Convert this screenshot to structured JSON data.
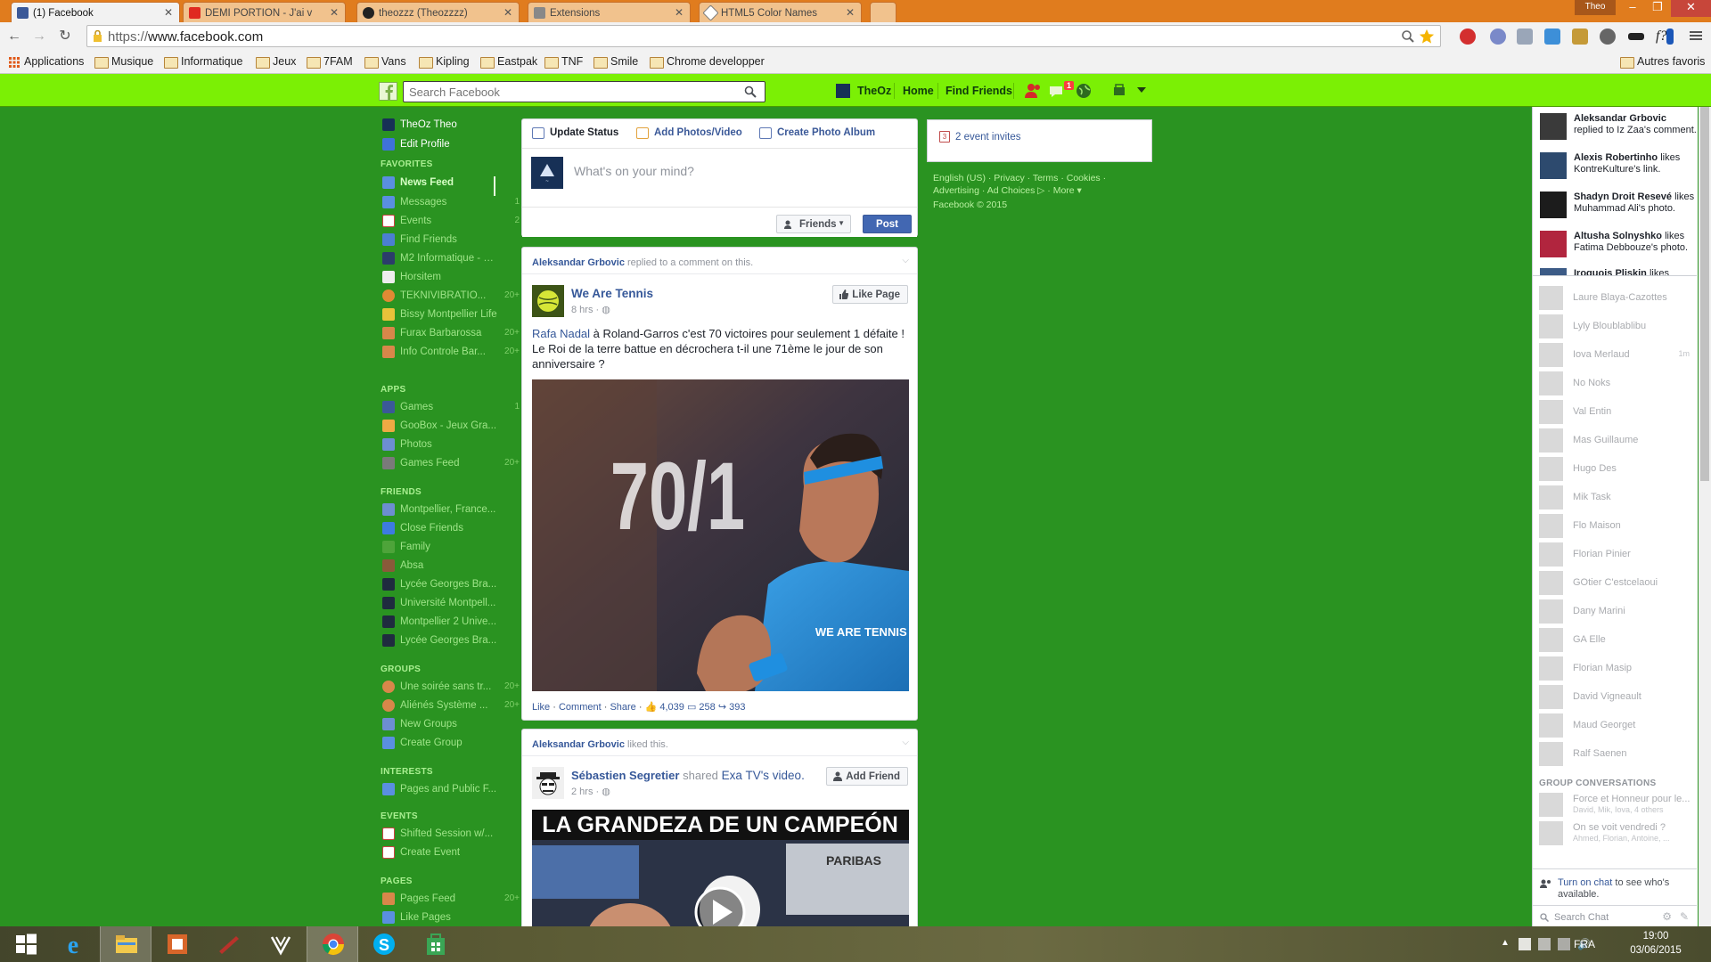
{
  "window": {
    "user_badge": "Theo",
    "tabs": [
      {
        "title": "(1) Facebook",
        "active": true
      },
      {
        "title": "DEMI PORTION - J'ai v"
      },
      {
        "title": "theozzz (Theozzzz)"
      },
      {
        "title": "Extensions"
      },
      {
        "title": "HTML5 Color Names"
      }
    ]
  },
  "toolbar": {
    "url_scheme": "https://",
    "url_host": "www.facebook.com"
  },
  "bookmarks": {
    "items": [
      "Applications",
      "Musique",
      "Informatique",
      "Jeux",
      "7FAM",
      "Vans",
      "Kipling",
      "Eastpak",
      "TNF",
      "Smile",
      "Chrome developper"
    ],
    "other": "Autres favoris"
  },
  "fbbar": {
    "search_placeholder": "Search Facebook",
    "profile_name": "TheOz",
    "home": "Home",
    "find_friends": "Find Friends",
    "notif_count": "1"
  },
  "leftnav": {
    "profile": {
      "name": "TheOz Theo",
      "edit": "Edit Profile"
    },
    "favorites_head": "FAVORITES",
    "favorites": [
      {
        "label": "News Feed",
        "count": ""
      },
      {
        "label": "Messages",
        "count": "1"
      },
      {
        "label": "Events",
        "count": "2"
      },
      {
        "label": "Find Friends",
        "count": ""
      },
      {
        "label": "M2 Informatique - U...",
        "count": ""
      },
      {
        "label": "Horsitem",
        "count": ""
      },
      {
        "label": "TEKNIVIBRATIO...",
        "count": "20+"
      },
      {
        "label": "Bissy Montpellier Life",
        "count": ""
      },
      {
        "label": "Furax Barbarossa",
        "count": "20+"
      },
      {
        "label": "Info Controle Bar...",
        "count": "20+"
      }
    ],
    "apps_head": "APPS",
    "apps": [
      {
        "label": "Games",
        "count": "1"
      },
      {
        "label": "GooBox - Jeux Gra...",
        "count": ""
      },
      {
        "label": "Photos",
        "count": ""
      },
      {
        "label": "Games Feed",
        "count": "20+"
      }
    ],
    "friends_head": "FRIENDS",
    "friends": [
      {
        "label": "Montpellier, France..."
      },
      {
        "label": "Close Friends"
      },
      {
        "label": "Family"
      },
      {
        "label": "Absa"
      },
      {
        "label": "Lycée Georges Bra..."
      },
      {
        "label": "Université Montpell..."
      },
      {
        "label": "Montpellier 2 Unive..."
      },
      {
        "label": "Lycée Georges Bra..."
      }
    ],
    "groups_head": "GROUPS",
    "groups": [
      {
        "label": "Une soirée sans tr...",
        "count": "20+"
      },
      {
        "label": "Aliénés Système ...",
        "count": "20+"
      },
      {
        "label": "New Groups",
        "count": ""
      },
      {
        "label": "Create Group",
        "count": ""
      }
    ],
    "interests_head": "INTERESTS",
    "interests": [
      {
        "label": "Pages and Public F..."
      }
    ],
    "events_head": "EVENTS",
    "events": [
      {
        "label": "Shifted Session w/..."
      },
      {
        "label": "Create Event"
      }
    ],
    "pages_head": "PAGES",
    "pages": [
      {
        "label": "Pages Feed",
        "count": "20+"
      },
      {
        "label": "Like Pages",
        "count": ""
      }
    ]
  },
  "composer": {
    "update_status": "Update Status",
    "add_photos": "Add Photos/Video",
    "create_album": "Create Photo Album",
    "placeholder": "What's on your mind?",
    "audience": "Friends",
    "post": "Post"
  },
  "story1": {
    "actor": "Aleksandar Grbovic",
    "action": "replied to a comment on this.",
    "page": "We Are Tennis",
    "time": "8 hrs",
    "like_page": "Like Page",
    "text_link": "Rafa Nadal",
    "text_rest": " à Roland-Garros c'est 70 victoires pour seulement 1 défaite ! Le Roi de la terre battue en décrochera t-il une 71ème le jour de son anniversaire ?",
    "image_score": "70/1",
    "image_brand": "WE ARE TENNIS .COM",
    "like": "Like",
    "comment": "Comment",
    "share": "Share",
    "likes": "4,039",
    "comments": "258",
    "shares": "393"
  },
  "story2": {
    "actor": "Aleksandar Grbovic",
    "action": "liked this.",
    "name": "Sébastien Segretier",
    "shared": "shared",
    "source": "Exa TV's",
    "object": "video.",
    "time": "2 hrs",
    "add_friend": "Add Friend",
    "video_title": "LA GRANDEZA DE UN CAMPEÓN",
    "video_sponsor": "PARIBAS"
  },
  "right": {
    "event_invites": "2 event invites",
    "footer_line1": "English (US) · Privacy · Terms · Cookies ·",
    "footer_line2": "Advertising · Ad Choices ▷ · More ▾",
    "footer_line3": "Facebook © 2015"
  },
  "ticker": [
    {
      "name": "Aleksandar Grbovic",
      "rest": "replied to Iz Zaa's comment."
    },
    {
      "name": "Alexis Robertinho",
      "rest": "likes KontreKulture's link."
    },
    {
      "name": "Shadyn Droit Resevé",
      "rest": "likes Muhammad Ali's photo."
    },
    {
      "name": "Altusha Solnyshko",
      "rest": "likes Fatima Debbouze's photo."
    },
    {
      "name": "Iroquois Pliskin",
      "rest": "likes"
    }
  ],
  "chat": {
    "contacts": [
      {
        "name": "Laure Blaya-Cazottes",
        "mobile": ""
      },
      {
        "name": "Lyly Bloublablibu",
        "mobile": ""
      },
      {
        "name": "Iova Merlaud",
        "mobile": "1m"
      },
      {
        "name": "No Noks",
        "mobile": ""
      },
      {
        "name": "Val Entin",
        "mobile": ""
      },
      {
        "name": "Mas Guillaume",
        "mobile": ""
      },
      {
        "name": "Hugo Des",
        "mobile": ""
      },
      {
        "name": "Mik Task",
        "mobile": ""
      },
      {
        "name": "Flo Maison",
        "mobile": ""
      },
      {
        "name": "Florian Pinier",
        "mobile": ""
      },
      {
        "name": "GOtier C'estcelaoui",
        "mobile": ""
      },
      {
        "name": "Dany Marini",
        "mobile": ""
      },
      {
        "name": "GA Elle",
        "mobile": ""
      },
      {
        "name": "Florian Masip",
        "mobile": ""
      },
      {
        "name": "David Vigneault",
        "mobile": ""
      },
      {
        "name": "Maud Georget",
        "mobile": ""
      },
      {
        "name": "Ralf Saenen",
        "mobile": ""
      }
    ],
    "group_head": "GROUP CONVERSATIONS",
    "groups": [
      {
        "name": "Force et Honneur pour le...",
        "sub": "David, Mik, Iova, 4 others"
      },
      {
        "name": "On se voit vendredi ?",
        "sub": "Ahmed, Florian, Antoine, ..."
      }
    ],
    "turn_on_link": "Turn on chat",
    "turn_on_rest": " to see who's available.",
    "search": "Search Chat"
  },
  "taskbar": {
    "lang": "FRA",
    "time": "19:00",
    "date": "03/06/2015"
  },
  "colors": {
    "fb_bar": "#7bf005",
    "page_bg": "#2a9321",
    "chrome_title": "#e07c1e",
    "link": "#365899"
  }
}
